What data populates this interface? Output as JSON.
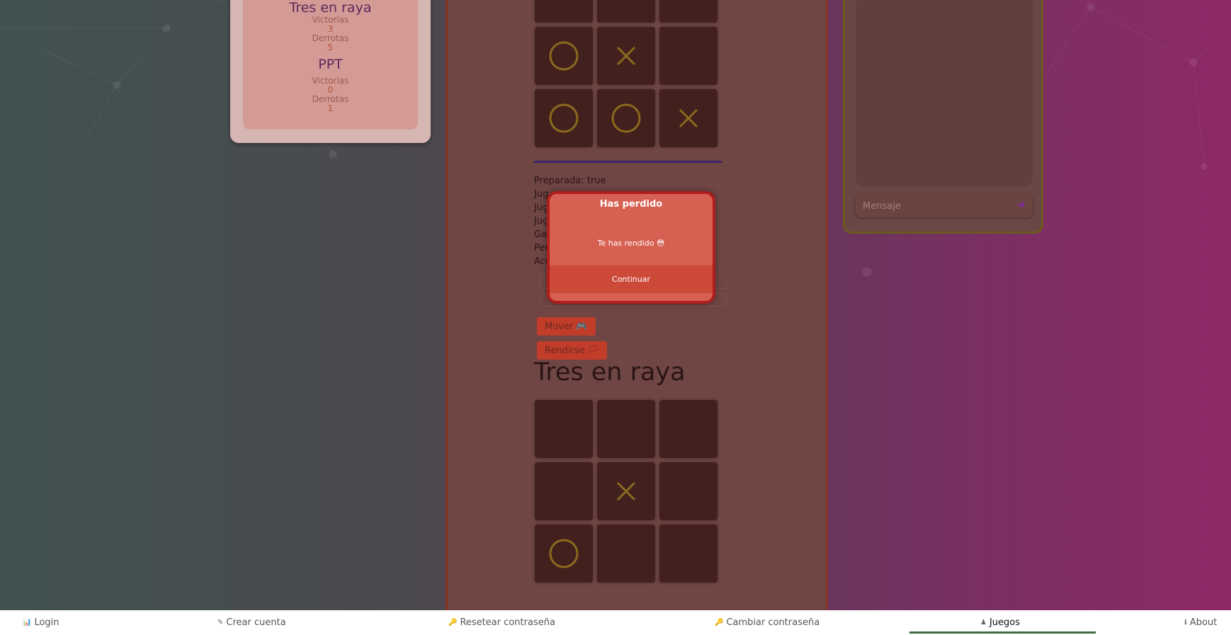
{
  "stats": {
    "games": [
      {
        "name": "Tres en raya",
        "victorias_label": "Victorias",
        "victorias": "3",
        "derrotas_label": "Derrotas",
        "derrotas": "5"
      },
      {
        "name": "PPT",
        "victorias_label": "Victorias",
        "victorias": "0",
        "derrotas_label": "Derrotas",
        "derrotas": "1"
      }
    ]
  },
  "game": {
    "board1": [
      "",
      "",
      "",
      "O",
      "X",
      "",
      "O",
      "O",
      "X"
    ],
    "board2": [
      "",
      "",
      "",
      "",
      "X",
      "",
      "O",
      "",
      ""
    ],
    "info_lines": [
      "Preparada: true",
      "Jug",
      "Jug",
      "Jug",
      "Gar",
      "Per",
      "Acc"
    ],
    "move_button": "Mover 🎮",
    "surrender_button": "Rendirse 🏳",
    "title": "Tres en raya",
    "mark_color": "#8a6a1e"
  },
  "chat": {
    "placeholder": "Mensaje"
  },
  "modal": {
    "title": "Has perdido",
    "body": "Te has rendido 😳",
    "button": "Continuar"
  },
  "nav": {
    "items": [
      {
        "icon": "📊",
        "label": "Login"
      },
      {
        "icon": "✎",
        "label": "Crear cuenta"
      },
      {
        "icon": "🔑",
        "label": "Resetear contraseña"
      },
      {
        "icon": "🔑",
        "label": "Cambiar contraseña"
      },
      {
        "icon": "♟",
        "label": "Juegos"
      },
      {
        "icon": "ℹ",
        "label": "About"
      }
    ]
  }
}
